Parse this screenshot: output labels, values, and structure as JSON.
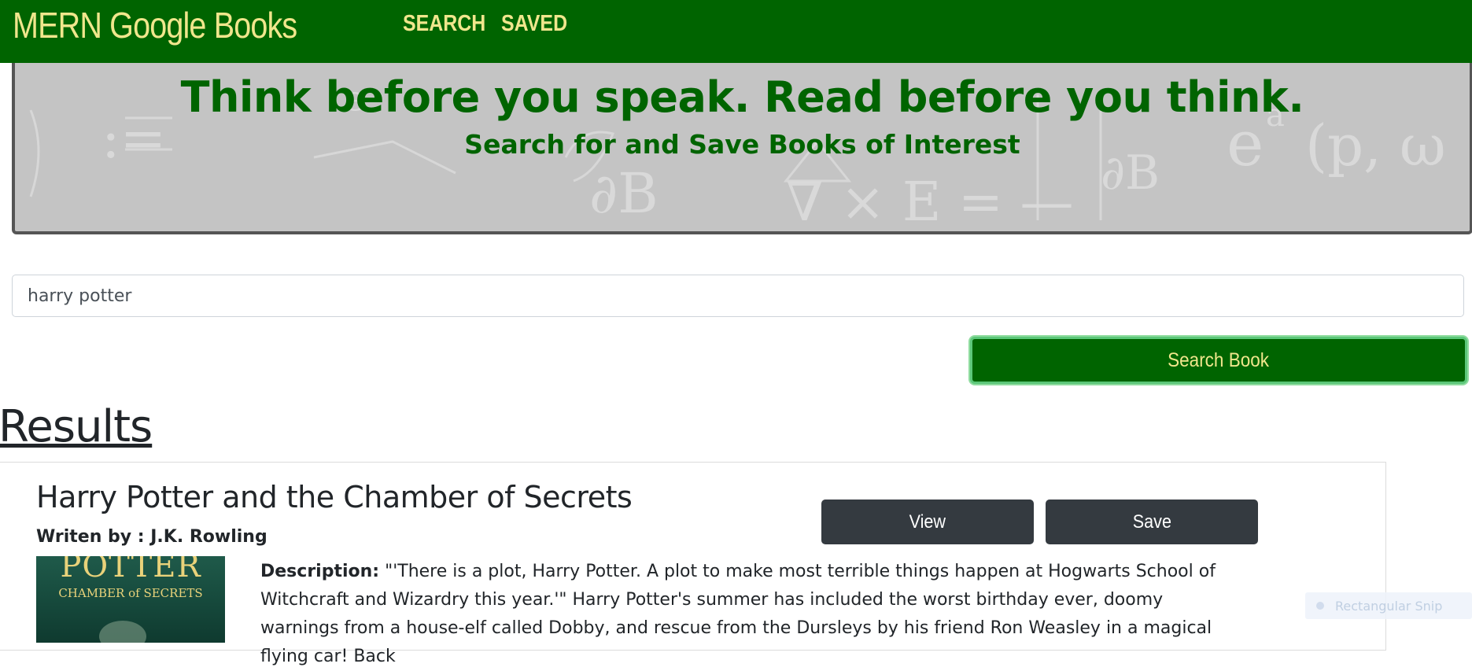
{
  "navbar": {
    "brand": "MERN Google Books",
    "links": [
      {
        "label": "SEARCH"
      },
      {
        "label": "SAVED"
      }
    ],
    "color": "#006400",
    "text_color": "#f0e68c"
  },
  "jumbotron": {
    "title": "Think before you speak. Read before you think.",
    "subtitle": "Search for and Save Books of Interest",
    "title_color": "#006400",
    "background": "math-equations-chalkboard"
  },
  "search": {
    "value": "harry potter",
    "button_label": "Search Book"
  },
  "results": {
    "heading": "Results",
    "books": [
      {
        "title": "Harry Potter and the Chamber of Secrets",
        "author_prefix": "Writen by : ",
        "author": "J.K. Rowling",
        "view_label": "View",
        "save_label": "Save",
        "cover_title": "POTTER",
        "cover_subtitle": "CHAMBER of SECRETS",
        "description_label": "Description:",
        "description": "\"'There is a plot, Harry Potter. A plot to make most terrible things happen at Hogwarts School of Witchcraft and Wizardry this year.'\" Harry Potter's summer has included the worst birthday ever, doomy warnings from a house-elf called Dobby, and rescue from the Dursleys by his friend Ron Weasley in a magical flying car! Back"
      }
    ]
  },
  "overlay": {
    "snip_label": "Rectangular Snip"
  }
}
